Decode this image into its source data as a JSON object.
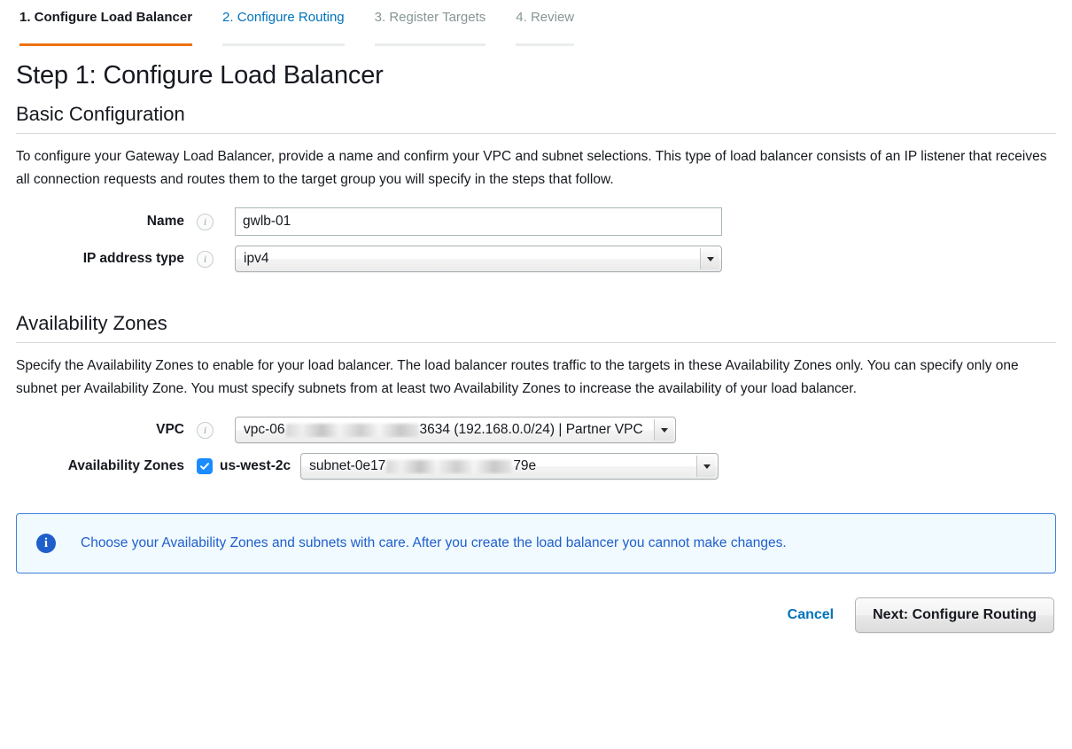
{
  "wizard": {
    "tabs": [
      {
        "label": "1. Configure Load Balancer",
        "state": "active"
      },
      {
        "label": "2. Configure Routing",
        "state": "link"
      },
      {
        "label": "3. Register Targets",
        "state": "done"
      },
      {
        "label": "4. Review",
        "state": "done"
      }
    ]
  },
  "page": {
    "title": "Step 1: Configure Load Balancer"
  },
  "basic": {
    "section_title": "Basic Configuration",
    "description": "To configure your Gateway Load Balancer, provide a name and confirm your VPC and subnet selections. This type of load balancer consists of an IP listener that receives all connection requests and routes them to the target group you will specify in the steps that follow.",
    "name_label": "Name",
    "name_value": "gwlb-01",
    "ip_type_label": "IP address type",
    "ip_type_value": "ipv4",
    "info_glyph": "i"
  },
  "availability": {
    "section_title": "Availability Zones",
    "description": "Specify the Availability Zones to enable for your load balancer. The load balancer routes traffic to the targets in these Availability Zones only. You can specify only one subnet per Availability Zone. You must specify subnets from at least two Availability Zones to increase the availability of your load balancer.",
    "vpc_label": "VPC",
    "vpc_value_prefix": "vpc-06",
    "vpc_value_suffix": "3634 (192.168.0.0/24) | Partner VPC",
    "az_label": "Availability Zones",
    "zone_name": "us-west-2c",
    "subnet_value_prefix": "subnet-0e17",
    "subnet_value_suffix": "79e"
  },
  "alert": {
    "icon_glyph": "i",
    "message": "Choose your Availability Zones and subnets with care. After you create the load balancer you cannot make changes."
  },
  "footer": {
    "cancel_label": "Cancel",
    "next_label": "Next: Configure Routing"
  },
  "colors": {
    "accent_orange": "#ec7211",
    "link_blue": "#0073bb",
    "alert_blue": "#1f5fcc",
    "alert_bg": "#f1faff",
    "checkbox_blue": "#1a8cff"
  }
}
